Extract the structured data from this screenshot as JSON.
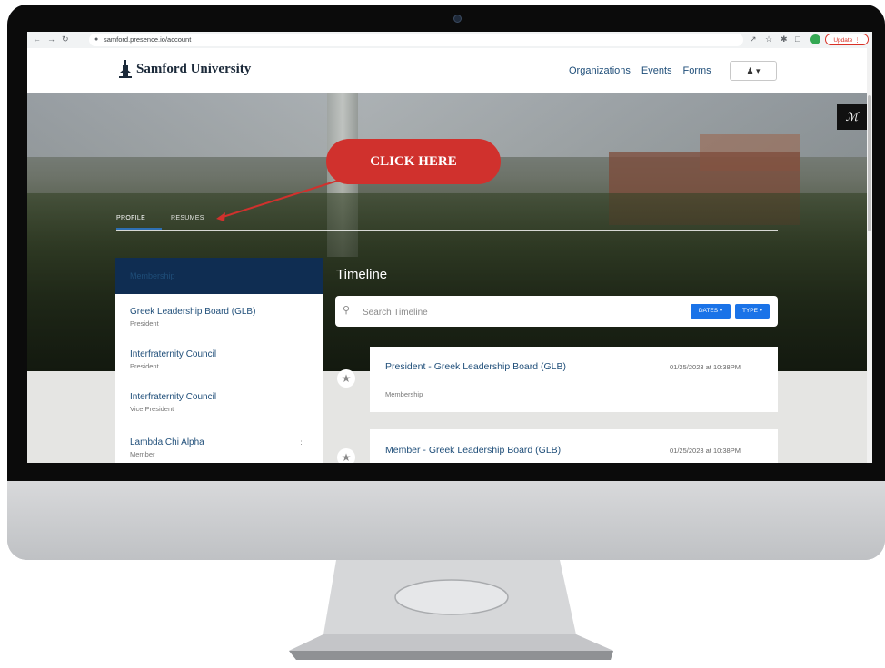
{
  "browser": {
    "url": "samford.presence.io/account",
    "update_label": "Update"
  },
  "site": {
    "logo_text": "Samford University",
    "nav": [
      "Organizations",
      "Events",
      "Forms"
    ],
    "user_menu_icons": "♣ ▾",
    "m_badge": "ℳ"
  },
  "hero": {
    "tabs": [
      "PROFILE",
      "RESUMES"
    ],
    "callout": "CLICK HERE"
  },
  "sidebar": {
    "heading": "Membership",
    "items": [
      {
        "title": "Greek Leadership Board (GLB)",
        "role": "President"
      },
      {
        "title": "Interfraternity Council",
        "role": "President"
      },
      {
        "title": "Interfraternity Council",
        "role": "Vice President"
      },
      {
        "title": "Lambda Chi Alpha",
        "role": "Member"
      }
    ]
  },
  "timeline": {
    "title": "Timeline",
    "search_placeholder": "Search Timeline",
    "dates_label": "DATES ▾",
    "type_label": "TYPE ▾",
    "entries": [
      {
        "title": "President - Greek Leadership Board (GLB)",
        "type": "Membership",
        "date": "01/25/2023 at 10:38PM"
      },
      {
        "title": "Member - Greek Leadership Board (GLB)",
        "type": "",
        "date": "01/25/2023 at 10:38PM"
      }
    ]
  },
  "colors": {
    "accent": "#1a73e8",
    "callout": "#d0312d",
    "navy": "#0f2d52",
    "link": "#1f4e79"
  },
  "icons": [
    "back-icon",
    "forward-icon",
    "reload-icon",
    "lock-icon",
    "share-icon",
    "star-icon",
    "puzzle-icon",
    "sidebar-icon",
    "profile-dot-icon",
    "menu-dots-icon",
    "search-icon",
    "user-icon",
    "chevron-down-icon",
    "kebab-icon",
    "timeline-star-icon"
  ]
}
